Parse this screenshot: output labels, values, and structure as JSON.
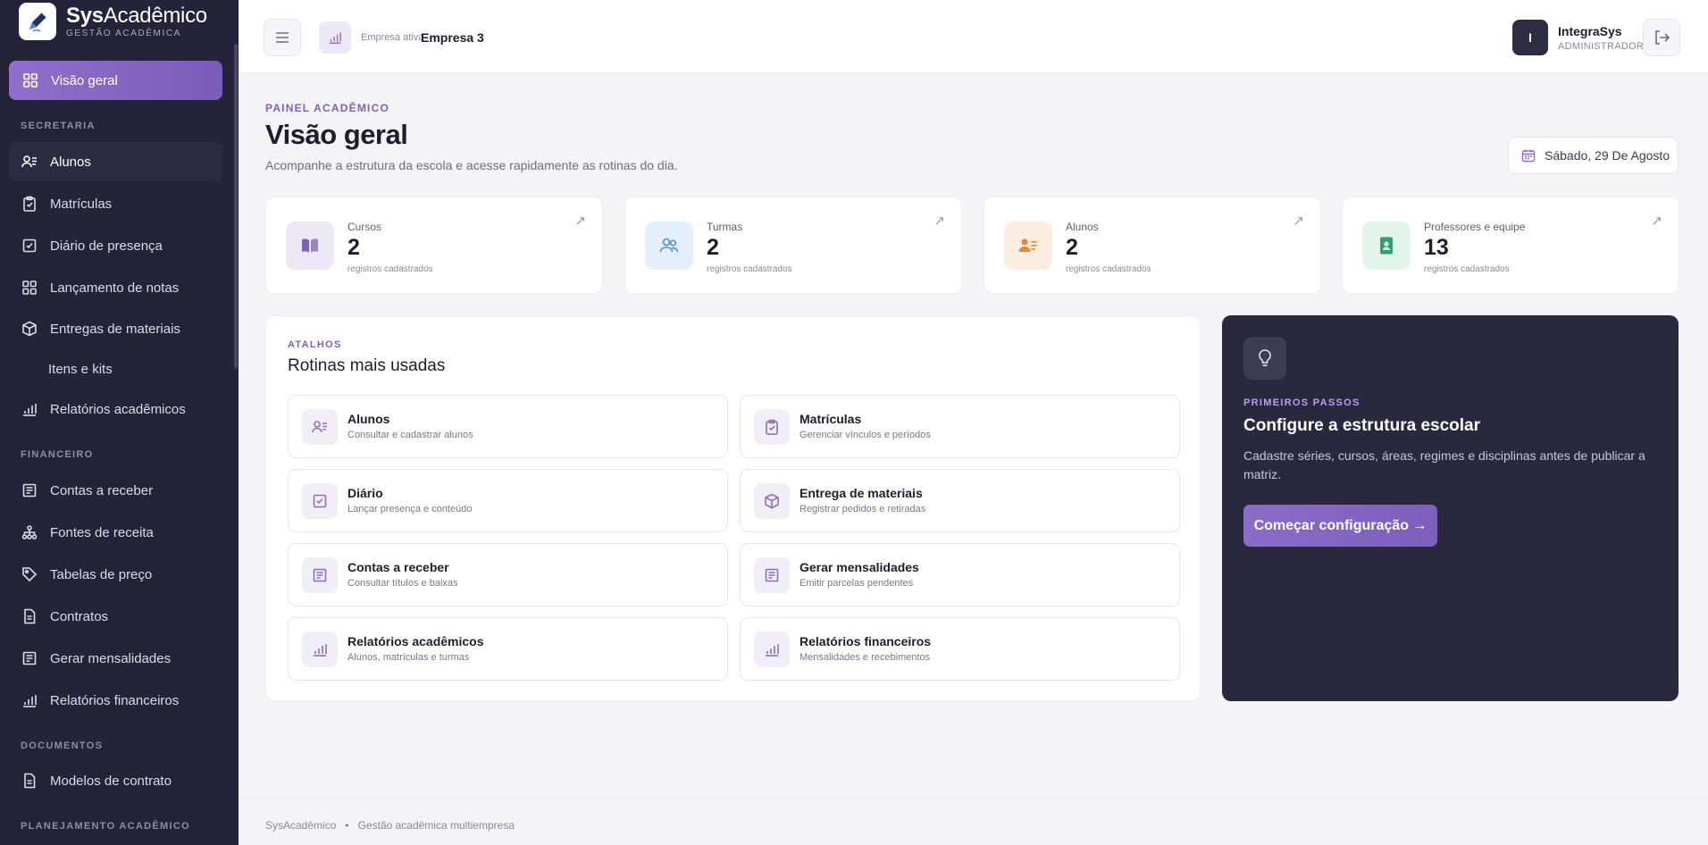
{
  "brand": {
    "name_bold": "Sys",
    "name_rest": "Acadêmico",
    "subtitle": "GESTÃO ACADÊMICA"
  },
  "sidebar": {
    "active": {
      "label": "Visão geral",
      "icon": "grid-icon"
    },
    "sections": [
      {
        "title": "SECRETARIA"
      },
      {
        "title": "FINANCEIRO"
      },
      {
        "title": "DOCUMENTOS"
      },
      {
        "title": "PLANEJAMENTO ACADÊMICO"
      }
    ],
    "items": [
      {
        "label": "Alunos",
        "icon": "users-icon"
      },
      {
        "label": "Matrículas",
        "icon": "clipboard-icon"
      },
      {
        "label": "Diário de presença",
        "icon": "check-square-icon"
      },
      {
        "label": "Lançamento de notas",
        "icon": "grid-icon"
      },
      {
        "label": "Entregas de materiais",
        "icon": "box-icon"
      },
      {
        "label": "Itens e kits",
        "icon": ""
      },
      {
        "label": "Relatórios acadêmicos",
        "icon": "bar-chart-icon"
      },
      {
        "label": "Contas a receber",
        "icon": "receipt-icon"
      },
      {
        "label": "Fontes de receita",
        "icon": "network-icon"
      },
      {
        "label": "Tabelas de preço",
        "icon": "tag-icon"
      },
      {
        "label": "Contratos",
        "icon": "file-icon"
      },
      {
        "label": "Gerar mensalidades",
        "icon": "receipt-icon"
      },
      {
        "label": "Relatórios financeiros",
        "icon": "bar-chart-icon"
      },
      {
        "label": "Modelos de contrato",
        "icon": "file-icon"
      }
    ]
  },
  "header": {
    "company_label": "Empresa ativa",
    "company_name": "Empresa 3",
    "user_initial": "I",
    "user_name": "IntegraSys",
    "user_role": "ADMINISTRADOR"
  },
  "page": {
    "eyebrow": "PAINEL ACADÊMICO",
    "title": "Visão geral",
    "subtitle": "Acompanhe a estrutura da escola e acesse rapidamente as rotinas do dia.",
    "date": "Sábado, 29 De Agosto"
  },
  "stats": [
    {
      "label": "Cursos",
      "value": "2",
      "caption": "registros cadastrados",
      "icon": "book-icon",
      "color": "#7e62b8"
    },
    {
      "label": "Turmas",
      "value": "2",
      "caption": "registros cadastrados",
      "icon": "users-icon",
      "color": "#4b8fd6"
    },
    {
      "label": "Alunos",
      "value": "2",
      "caption": "registros cadastrados",
      "icon": "users-icon",
      "color": "#e08a3c"
    },
    {
      "label": "Professores e equipe",
      "value": "13",
      "caption": "registros cadastrados",
      "icon": "id-badge-icon",
      "color": "#2f9f74"
    }
  ],
  "routines": {
    "eyebrow": "ATALHOS",
    "title": "Rotinas mais usadas",
    "tiles": [
      {
        "title": "Alunos",
        "subtitle": "Consultar e cadastrar alunos",
        "icon": "users-icon"
      },
      {
        "title": "Matrículas",
        "subtitle": "Gerenciar vínculos e períodos",
        "icon": "clipboard-icon"
      },
      {
        "title": "Diário",
        "subtitle": "Lançar presença e conteúdo",
        "icon": "check-square-icon"
      },
      {
        "title": "Entrega de materiais",
        "subtitle": "Registrar pedidos e retiradas",
        "icon": "box-icon"
      },
      {
        "title": "Contas a receber",
        "subtitle": "Consultar títulos e baixas",
        "icon": "receipt-icon"
      },
      {
        "title": "Gerar mensalidades",
        "subtitle": "Emitir parcelas pendentes",
        "icon": "receipt-icon"
      },
      {
        "title": "Relatórios acadêmicos",
        "subtitle": "Alunos, matrículas e turmas",
        "icon": "bar-chart-icon"
      },
      {
        "title": "Relatórios financeiros",
        "subtitle": "Mensalidades e recebimentos",
        "icon": "bar-chart-icon"
      }
    ]
  },
  "setup": {
    "eyebrow": "PRIMEIROS PASSOS",
    "title": "Configure a estrutura escolar",
    "description": "Cadastre séries, cursos, áreas, regimes e disciplinas antes de publicar a matriz.",
    "button": "Começar configuração →"
  },
  "footer": {
    "app": "SysAcadêmico",
    "separator": "•",
    "tagline": "Gestão acadêmica multiempresa"
  }
}
